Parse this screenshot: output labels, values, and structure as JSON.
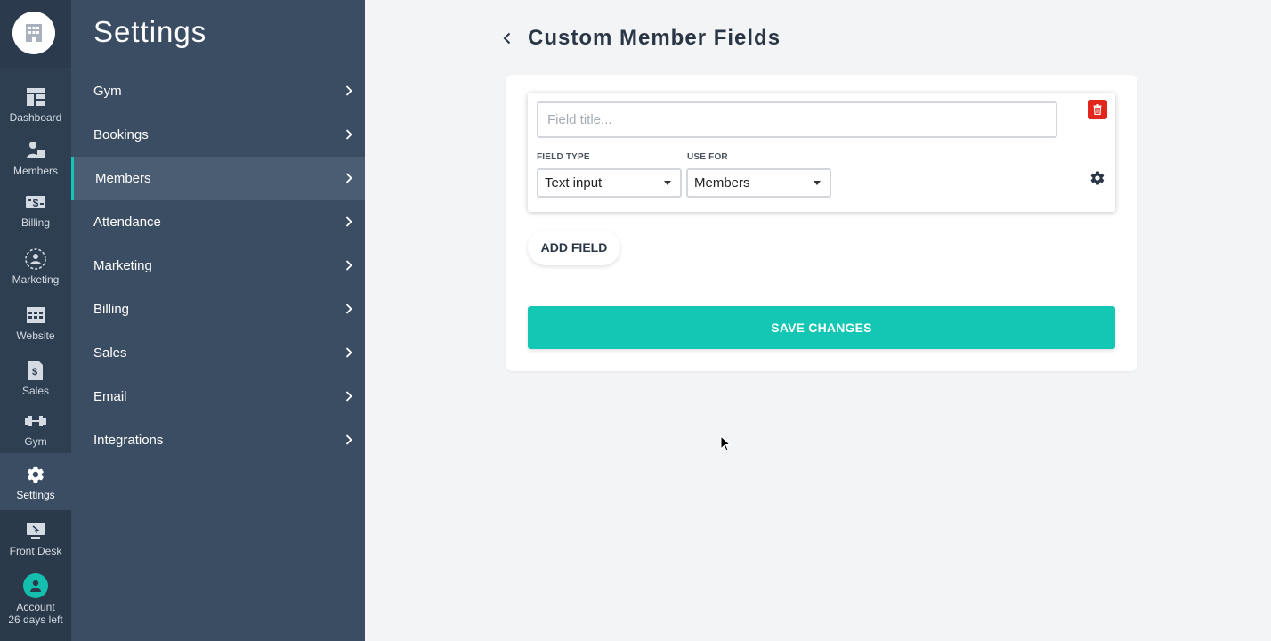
{
  "rail": {
    "items": [
      {
        "label": "Dashboard",
        "icon": "dashboard-icon"
      },
      {
        "label": "Members",
        "icon": "members-icon"
      },
      {
        "label": "Billing",
        "icon": "billing-icon"
      },
      {
        "label": "Marketing",
        "icon": "marketing-icon"
      },
      {
        "label": "Website",
        "icon": "website-icon"
      },
      {
        "label": "Sales",
        "icon": "sales-icon"
      },
      {
        "label": "Gym",
        "icon": "dumbbell-icon"
      },
      {
        "label": "Settings",
        "icon": "gear-icon"
      },
      {
        "label": "Front Desk",
        "icon": "front-desk-icon"
      }
    ],
    "active": "Settings",
    "account": {
      "label": "Account",
      "sub": "26 days left"
    }
  },
  "settings": {
    "title": "Settings",
    "items": [
      "Gym",
      "Bookings",
      "Members",
      "Attendance",
      "Marketing",
      "Billing",
      "Sales",
      "Email",
      "Integrations"
    ],
    "active": "Members"
  },
  "main": {
    "title": "Custom Member Fields",
    "field": {
      "title_placeholder": "Field title...",
      "field_type_label": "FIELD TYPE",
      "field_type_value": "Text input",
      "use_for_label": "USE FOR",
      "use_for_value": "Members"
    },
    "add_field_label": "ADD FIELD",
    "save_label": "SAVE CHANGES"
  },
  "colors": {
    "accent": "#14c6b4",
    "delete": "#e3261c",
    "rail": "#2e3f52",
    "panel": "#3b4d62"
  }
}
